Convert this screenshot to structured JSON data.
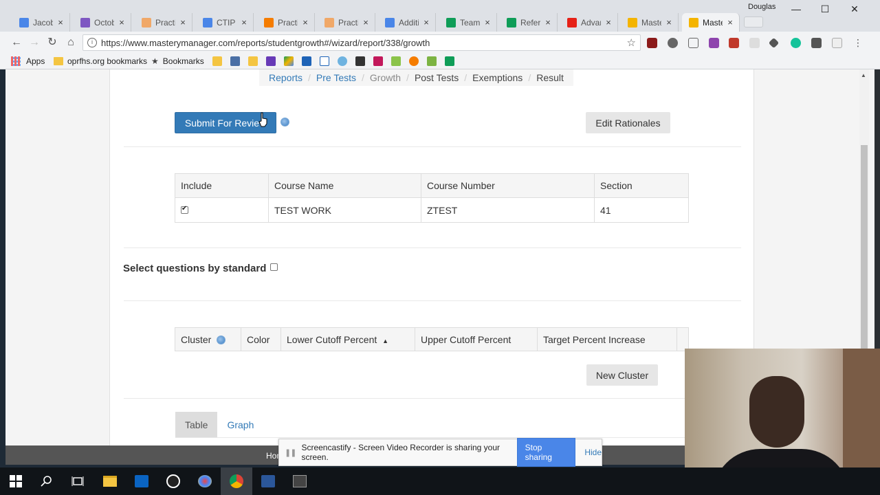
{
  "browser": {
    "profile_name": "Douglas",
    "tabs": [
      {
        "label": "Jacob",
        "icon": "docs-icon",
        "color": "#4a86e8"
      },
      {
        "label": "Octob",
        "icon": "forms-icon",
        "color": "#7e57c2"
      },
      {
        "label": "Practi",
        "icon": "e-icon",
        "color": "#f0a868"
      },
      {
        "label": "CTIP N",
        "icon": "docs-icon",
        "color": "#4a86e8"
      },
      {
        "label": "Practi",
        "icon": "flame-icon",
        "color": "#f57c00"
      },
      {
        "label": "Practi",
        "icon": "e-icon",
        "color": "#f0a868"
      },
      {
        "label": "Additi",
        "icon": "docs-icon",
        "color": "#4a86e8"
      },
      {
        "label": "Team t",
        "icon": "sheets-icon",
        "color": "#0f9d58"
      },
      {
        "label": "Refere",
        "icon": "sheets-icon",
        "color": "#0f9d58"
      },
      {
        "label": "Advan",
        "icon": "youtube-icon",
        "color": "#e62117"
      },
      {
        "label": "Maste",
        "icon": "slides-icon",
        "color": "#f4b400"
      },
      {
        "label": "Maste",
        "icon": "star-icon",
        "color": "#f4b400"
      }
    ],
    "url": "https://www.masterymanager.com/reports/studentgrowth#/wizard/report/338/growth",
    "bookmarks": {
      "apps": "Apps",
      "folder": "oprfhs.org bookmarks",
      "bookmarks": "Bookmarks"
    }
  },
  "page": {
    "breadcrumbs": [
      {
        "label": "Reports",
        "kind": "link"
      },
      {
        "label": "Pre Tests",
        "kind": "link"
      },
      {
        "label": "Growth",
        "kind": "current"
      },
      {
        "label": "Post Tests",
        "kind": "plain"
      },
      {
        "label": "Exemptions",
        "kind": "plain"
      },
      {
        "label": "Result",
        "kind": "plain"
      }
    ],
    "submit_label": "Submit For Review",
    "edit_rationales_label": "Edit Rationales",
    "course_table": {
      "headers": [
        "Include",
        "Course Name",
        "Course Number",
        "Section"
      ],
      "rows": [
        {
          "include": true,
          "course_name": "TEST WORK",
          "course_number": "ZTEST",
          "section": "41"
        }
      ]
    },
    "select_by_standard_label": "Select questions by standard",
    "cluster_table": {
      "headers": [
        "Cluster",
        "Color",
        "Lower Cutoff Percent",
        "Upper Cutoff Percent",
        "Target Percent Increase"
      ],
      "sorted_column": "Lower Cutoff Percent",
      "sort_direction": "ascending"
    },
    "new_cluster_label": "New Cluster",
    "view_tabs": [
      {
        "label": "Table",
        "active": true
      },
      {
        "label": "Graph",
        "active": false
      }
    ],
    "footer_text": "Hom"
  },
  "screencastify": {
    "message": "Screencastify - Screen Video Recorder is sharing your screen.",
    "stop_label": "Stop sharing",
    "hide_label": "Hide"
  },
  "taskbar": {
    "items": [
      "windows-start-icon",
      "search-icon",
      "task-view-icon",
      "file-explorer-icon",
      "outlook-icon",
      "t-app-icon",
      "paint-icon",
      "chrome-icon",
      "word-icon",
      "video-editor-icon"
    ]
  }
}
